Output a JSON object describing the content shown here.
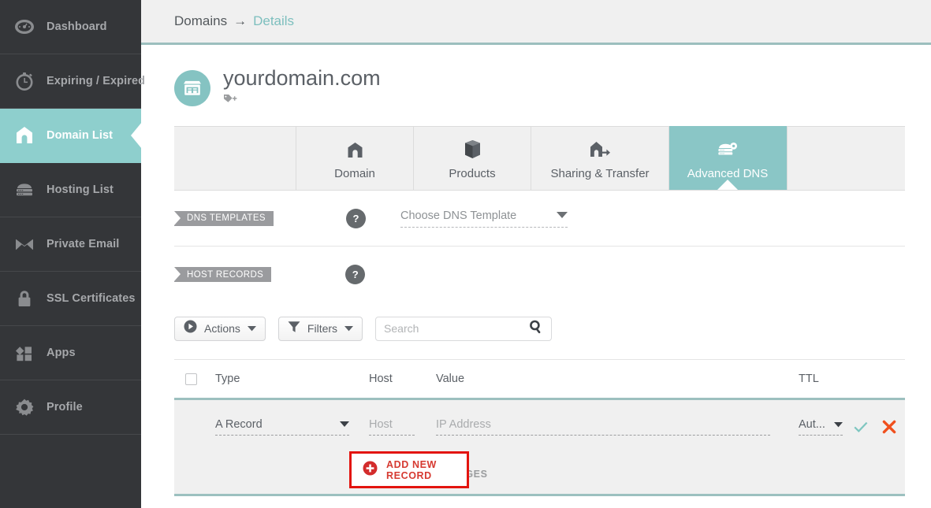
{
  "colors": {
    "teal": "#8ecfcd",
    "tab_active": "#8ac6c6",
    "sidebar_bg": "#343639",
    "accent_red": "#d63a31",
    "highlight_red": "#e3140f",
    "row_bg": "#f0f0f0",
    "rule_teal": "#9cc0bf",
    "delete_orange": "#f0501e",
    "check_teal": "#7ec6c0"
  },
  "sidebar": {
    "items": [
      {
        "label": "Dashboard",
        "icon": "gauge-icon",
        "active": false
      },
      {
        "label": "Expiring / Expired",
        "icon": "stopwatch-icon",
        "active": false
      },
      {
        "label": "Domain List",
        "icon": "house-icon",
        "active": true
      },
      {
        "label": "Hosting List",
        "icon": "server-icon",
        "active": false
      },
      {
        "label": "Private Email",
        "icon": "envelope-icon",
        "active": false
      },
      {
        "label": "SSL Certificates",
        "icon": "lock-icon",
        "active": false
      },
      {
        "label": "Apps",
        "icon": "blocks-icon",
        "active": false
      },
      {
        "label": "Profile",
        "icon": "gear-icon",
        "active": false
      }
    ]
  },
  "breadcrumb": {
    "root": "Domains",
    "separator": "→",
    "current": "Details"
  },
  "domain": {
    "name": "yourdomain.com",
    "icon": "storefront-icon",
    "tag_icon": "tag-plus-icon"
  },
  "tabs": [
    {
      "label": "Domain",
      "icon": "house-icon",
      "active": false
    },
    {
      "label": "Products",
      "icon": "box-icon",
      "active": false
    },
    {
      "label": "Sharing & Transfer",
      "icon": "transfer-icon",
      "active": false
    },
    {
      "label": "Advanced DNS",
      "icon": "server-dns-icon",
      "active": true
    }
  ],
  "sections": {
    "dns_templates": {
      "ribbon": "DNS TEMPLATES",
      "help": "?",
      "select_value": "Choose DNS Template"
    },
    "host_records": {
      "ribbon": "HOST RECORDS",
      "help": "?"
    }
  },
  "toolbar": {
    "actions_label": "Actions",
    "actions_icon": "play-circle-icon",
    "filters_label": "Filters",
    "filters_icon": "funnel-icon",
    "search_placeholder": "Search",
    "search_value": "",
    "search_icon": "magnifier-icon"
  },
  "table": {
    "columns": [
      "Type",
      "Host",
      "Value",
      "TTL"
    ],
    "rows": [
      {
        "type": "A Record",
        "host_placeholder": "Host",
        "host_value": "",
        "value_placeholder": "IP Address",
        "value_value": "",
        "ttl": "Aut...",
        "confirm_icon": "check-icon",
        "delete_icon": "x-icon"
      }
    ]
  },
  "action_bar": {
    "add_label": "ADD NEW RECORD",
    "add_icon": "plus-circle-icon",
    "save_label": "SAVE ALL CHANGES",
    "save_icon": "check-circle-icon"
  }
}
